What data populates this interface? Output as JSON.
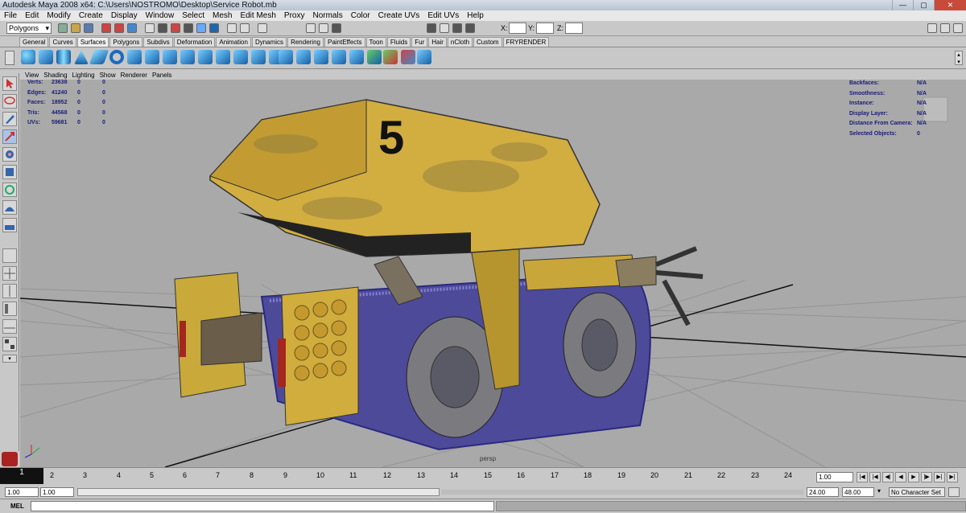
{
  "window": {
    "title": "Autodesk Maya 2008 x64: C:\\Users\\NOSTROMO\\Desktop\\Service Robot.mb"
  },
  "menu": [
    "File",
    "Edit",
    "Modify",
    "Create",
    "Display",
    "Window",
    "Select",
    "Mesh",
    "Edit Mesh",
    "Proxy",
    "Normals",
    "Color",
    "Create UVs",
    "Edit UVs",
    "Help"
  ],
  "statusline": {
    "mode": "Polygons",
    "x_label": "X:",
    "y_label": "Y:",
    "z_label": "Z:"
  },
  "shelf_tabs": [
    "General",
    "Curves",
    "Surfaces",
    "Polygons",
    "Subdivs",
    "Deformation",
    "Animation",
    "Dynamics",
    "Rendering",
    "PaintEffects",
    "Toon",
    "Fluids",
    "Fur",
    "Hair",
    "nCloth",
    "Custom",
    "FRYRENDER"
  ],
  "shelf_active": "Surfaces",
  "panel_menu": [
    "View",
    "Shading",
    "Lighting",
    "Show",
    "Renderer",
    "Panels"
  ],
  "hud_left": [
    {
      "label": "Verts:",
      "a": "23638",
      "b": "0",
      "c": "0"
    },
    {
      "label": "Edges:",
      "a": "41240",
      "b": "0",
      "c": "0"
    },
    {
      "label": "Faces:",
      "a": "18952",
      "b": "0",
      "c": "0"
    },
    {
      "label": "Tris:",
      "a": "44568",
      "b": "0",
      "c": "0"
    },
    {
      "label": "UVs:",
      "a": "59681",
      "b": "0",
      "c": "0"
    }
  ],
  "hud_right": [
    {
      "label": "Backfaces:",
      "value": "N/A"
    },
    {
      "label": "Smoothness:",
      "value": "N/A"
    },
    {
      "label": "Instance:",
      "value": "N/A"
    },
    {
      "label": "Display Layer:",
      "value": "N/A"
    },
    {
      "label": "Distance From Camera:",
      "value": "N/A"
    },
    {
      "label": "Selected Objects:",
      "value": "0"
    }
  ],
  "viewport": {
    "camera": "persp",
    "robot_number": "5"
  },
  "timeline": {
    "ticks": [
      "2",
      "3",
      "4",
      "5",
      "6",
      "7",
      "8",
      "9",
      "10",
      "11",
      "12",
      "13",
      "14",
      "15",
      "16",
      "17",
      "18",
      "19",
      "20",
      "21",
      "22",
      "23",
      "24"
    ],
    "current_frame": "1",
    "current_field": "1.00"
  },
  "range": {
    "start": "1.00",
    "start2": "1.00",
    "end": "24.00",
    "end2": "48.00",
    "character_set": "No Character Set"
  },
  "cmdline": {
    "label": "MEL"
  }
}
